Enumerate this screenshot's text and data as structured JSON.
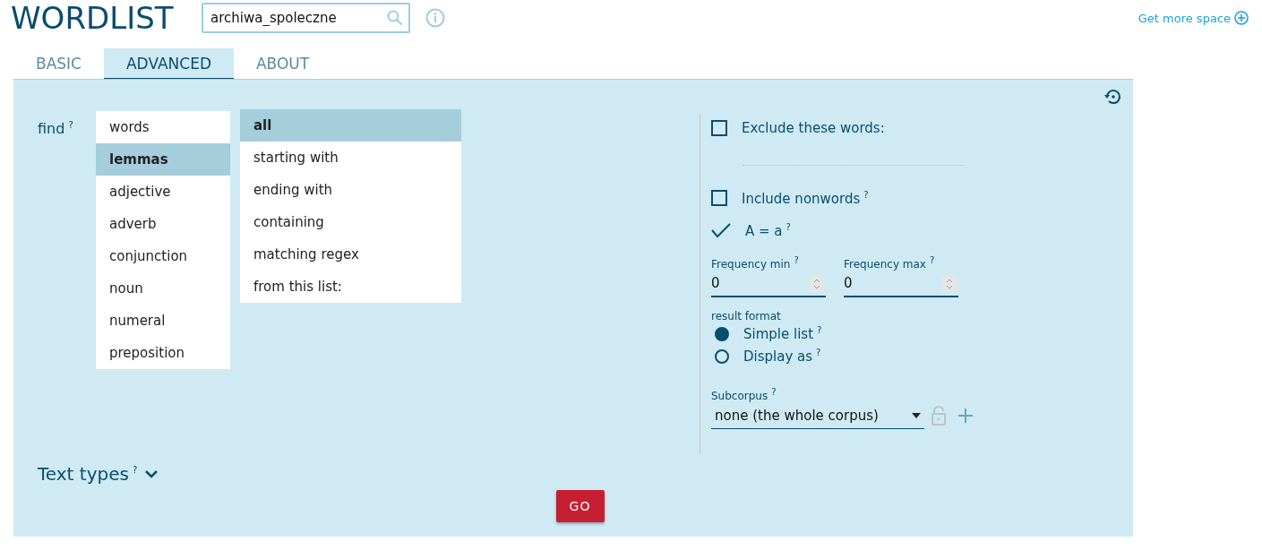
{
  "app_title": "WORDLIST",
  "corpus_search": {
    "value": "archiwa_spoleczne"
  },
  "header_link": "Get more space",
  "tabs": [
    {
      "label": "BASIC",
      "selected": false
    },
    {
      "label": "ADVANCED",
      "selected": true
    },
    {
      "label": "ABOUT",
      "selected": false
    }
  ],
  "find": {
    "label": "find",
    "help": "?",
    "attributes": [
      {
        "label": "words",
        "selected": false
      },
      {
        "label": "lemmas",
        "selected": true
      },
      {
        "label": "adjective",
        "selected": false
      },
      {
        "label": "adverb",
        "selected": false
      },
      {
        "label": "conjunction",
        "selected": false
      },
      {
        "label": "noun",
        "selected": false
      },
      {
        "label": "numeral",
        "selected": false
      },
      {
        "label": "preposition",
        "selected": false
      }
    ],
    "filters": [
      {
        "label": "all",
        "selected": true
      },
      {
        "label": "starting with",
        "selected": false
      },
      {
        "label": "ending with",
        "selected": false
      },
      {
        "label": "containing",
        "selected": false
      },
      {
        "label": "matching regex",
        "selected": false
      },
      {
        "label": "from this list:",
        "selected": false
      }
    ]
  },
  "options": {
    "exclude": {
      "label": "Exclude these words:",
      "checked": false
    },
    "checks": [
      {
        "label": "Include nonwords",
        "help": "?",
        "checked": false
      },
      {
        "label": "A = a",
        "help": "?",
        "checked": true
      }
    ],
    "frequency": [
      {
        "label": "Frequency min",
        "help": "?",
        "value": "0"
      },
      {
        "label": "Frequency max",
        "help": "?",
        "value": "0"
      }
    ],
    "result_format": {
      "label": "result format",
      "options": [
        {
          "label": "Simple list",
          "help": "?",
          "selected": true
        },
        {
          "label": "Display as",
          "help": "?",
          "selected": false
        }
      ]
    },
    "subcorpus": {
      "label": "Subcorpus",
      "help": "?",
      "value": "none (the whole corpus)"
    }
  },
  "text_types": {
    "label": "Text types",
    "help": "?",
    "expanded": false
  },
  "go_button": "GO"
}
